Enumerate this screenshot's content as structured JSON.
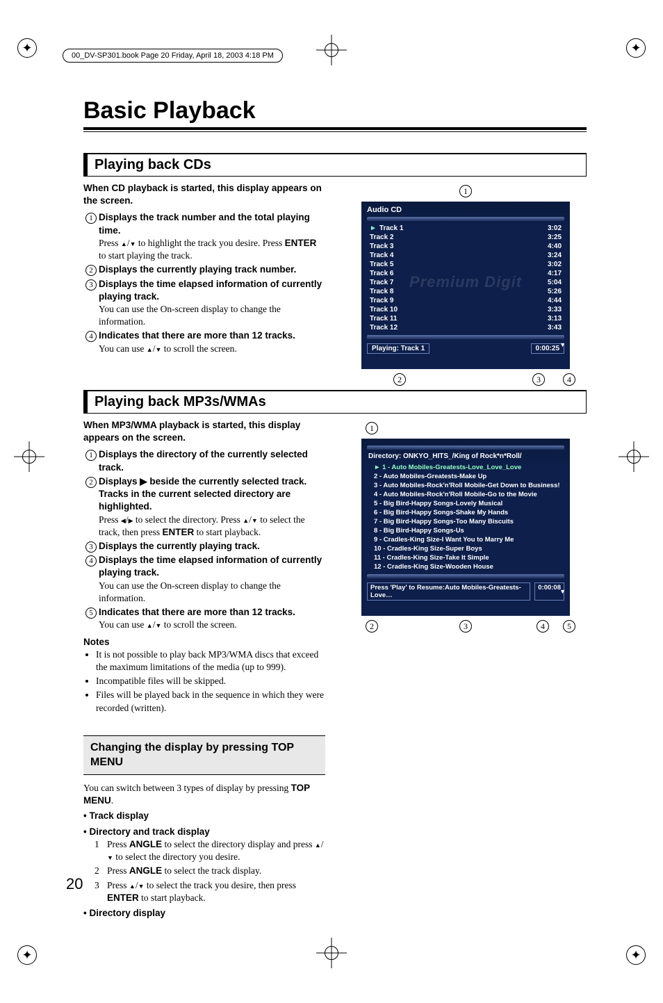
{
  "header_strip": "00_DV-SP301.book  Page 20  Friday, April 18, 2003  4:18 PM",
  "title": "Basic Playback",
  "page_number": "20",
  "cd_section": {
    "heading": "Playing back CDs",
    "intro": "When CD playback is started, this display appears on the screen.",
    "items": [
      {
        "num": "1",
        "main": "Displays the track number and the total playing time.",
        "sub_pre": "Press ",
        "sub_mid": " to highlight the track you desire. Press ",
        "sub_btn": "ENTER",
        "sub_post": " to start playing the track."
      },
      {
        "num": "2",
        "main": "Displays the currently playing track number."
      },
      {
        "num": "3",
        "main": "Displays the time elapsed information of currently playing track.",
        "sub": "You can use the On-screen display to change the information."
      },
      {
        "num": "4",
        "main": "Indicates that there are more than 12 tracks.",
        "sub_pre": "You can use ",
        "sub_post": " to scroll the screen."
      }
    ],
    "screen": {
      "header": "Audio CD",
      "tracks": [
        {
          "n": "Track 1",
          "t": "3:02",
          "sel": true
        },
        {
          "n": "Track 2",
          "t": "3:25"
        },
        {
          "n": "Track 3",
          "t": "4:40"
        },
        {
          "n": "Track 4",
          "t": "3:24"
        },
        {
          "n": "Track 5",
          "t": "3:02"
        },
        {
          "n": "Track 6",
          "t": "4:17"
        },
        {
          "n": "Track 7",
          "t": "5:04"
        },
        {
          "n": "Track 8",
          "t": "5:26"
        },
        {
          "n": "Track 9",
          "t": "4:44"
        },
        {
          "n": "Track 10",
          "t": "3:33"
        },
        {
          "n": "Track 11",
          "t": "3:13"
        },
        {
          "n": "Track 12",
          "t": "3:43"
        }
      ],
      "watermark": "Premium Digit",
      "playing": "Playing: Track 1",
      "elapsed": "0:00:25"
    },
    "callouts": [
      "1",
      "2",
      "3",
      "4"
    ]
  },
  "mp3_section": {
    "heading": "Playing back MP3s/WMAs",
    "intro": "When MP3/WMA playback is started, this display appears on the screen.",
    "items": [
      {
        "num": "1",
        "main": "Displays the directory of the currently selected track."
      },
      {
        "num": "2",
        "main_pre": "Displays ",
        "main_icon": "▶",
        "main_post": " beside the currently selected track. Tracks in the current selected directory are highlighted.",
        "sub_pre": "Press ",
        "sub_mid": " to select the directory. Press ",
        "sub_mid2": " to select the track, then press ",
        "sub_btn": "ENTER",
        "sub_post": " to start playback."
      },
      {
        "num": "3",
        "main": "Displays the currently playing track."
      },
      {
        "num": "4",
        "main": "Displays the time elapsed information of currently playing track.",
        "sub": "You can use the On-screen display to change the information."
      },
      {
        "num": "5",
        "main": "Indicates that there are more than 12 tracks.",
        "sub_pre": "You can use ",
        "sub_post": " to scroll the screen."
      }
    ],
    "notes_heading": "Notes",
    "notes": [
      "It is not possible to play back MP3/WMA discs that exceed the maximum limitations of the media (up to 999).",
      "Incompatible files will be skipped.",
      "Files will be played back in the sequence in which they were recorded (written)."
    ],
    "screen": {
      "directory": "Directory: ONKYO_HITS_/King of Rock*n*Roll/",
      "tracks": [
        "1 - Auto Mobiles-Greatests-Love_Love_Love",
        "2 - Auto Mobiles-Greatests-Make Up",
        "3 - Auto Mobiles-Rock'n'Roll Mobile-Get Down to Business!",
        "4 - Auto Mobiles-Rock'n'Roll Mobile-Go to the Movie",
        "5 - Big Bird-Happy Songs-Lovely Musical",
        "6 - Big Bird-Happy Songs-Shake My Hands",
        "7 - Big Bird-Happy Songs-Too Many Biscuits",
        "8 - Big Bird-Happy Songs-Us",
        "9 - Cradles-King Size-I Want You to Marry Me",
        "10 - Cradles-King Size-Super Boys",
        "11 - Cradles-King Size-Take It Simple",
        "12 - Cradles-King Size-Wooden House"
      ],
      "status": "Press 'Play' to Resume:Auto Mobiles-Greatests-Love…",
      "elapsed": "0:00:08"
    },
    "callouts": [
      "1",
      "2",
      "3",
      "4",
      "5"
    ]
  },
  "change_section": {
    "heading": "Changing the display by pressing TOP MENU",
    "intro_pre": "You can switch between 3 types of display by pressing ",
    "intro_btn": "TOP MENU",
    "intro_post": ".",
    "bullets": {
      "track": "• Track display",
      "dir_track": "• Directory and track display",
      "dir": "• Directory display"
    },
    "steps": [
      {
        "n": "1",
        "pre": "Press ",
        "btn": "ANGLE",
        "mid": " to select the directory display and press ",
        "post": " to select the directory you desire."
      },
      {
        "n": "2",
        "pre": "Press ",
        "btn": "ANGLE",
        "post": " to select the track display."
      },
      {
        "n": "3",
        "pre": "Press ",
        "mid": " to select the track you desire, then press ",
        "btn": "ENTER",
        "post": " to start playback."
      }
    ]
  }
}
